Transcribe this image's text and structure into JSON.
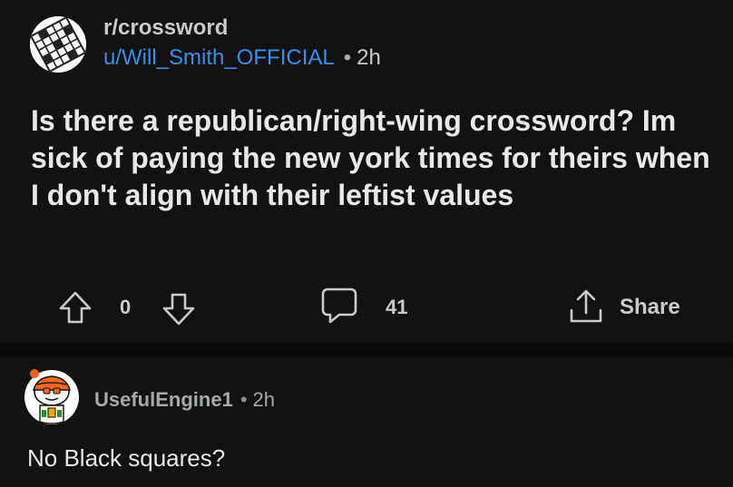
{
  "post": {
    "subreddit": "r/crossword",
    "author": "u/Will_Smith_OFFICIAL",
    "separator": "•",
    "time": "2h",
    "title": "Is there a republican/right-wing crossword? Im sick of paying the new york times for theirs when I don't align with their leftist values",
    "vote_count": "0",
    "comment_count": "41",
    "share_label": "Share"
  },
  "comment": {
    "author": "UsefulEngine1",
    "separator": "•",
    "time": "2h",
    "body": "No Black squares?"
  },
  "icons": {
    "subreddit_avatar": "crossword-grid-icon",
    "upvote": "arrow-up-icon",
    "downvote": "arrow-down-icon",
    "comments": "speech-bubble-icon",
    "share": "share-icon",
    "commenter_avatar": "snoo-avatar"
  },
  "colors": {
    "background": "#121212",
    "author_link": "#3c8ee6",
    "text": "#e6e8ea",
    "muted": "#c8cbcd"
  }
}
